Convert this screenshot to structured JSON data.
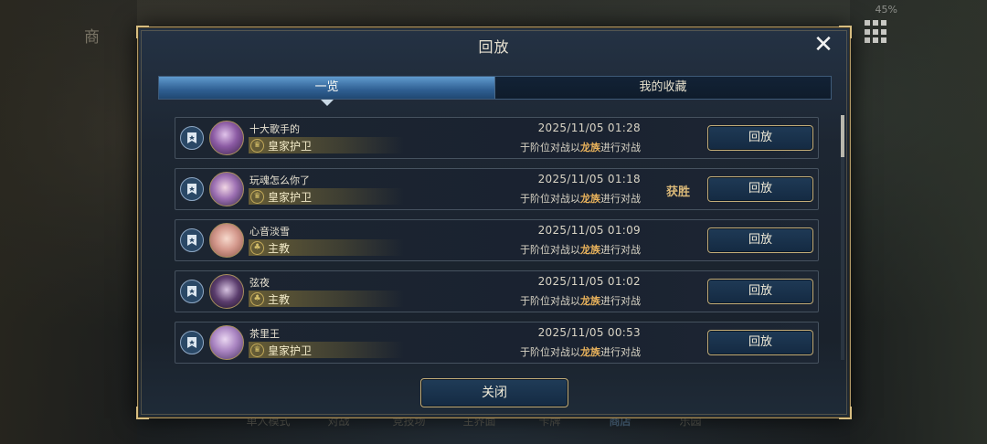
{
  "background": {
    "shop_label": "商",
    "status": {
      "battery": "45%"
    },
    "bottom_nav": [
      "单人模式",
      "对战",
      "竞技场",
      "主界面",
      "卡牌",
      "商店",
      "乐园"
    ]
  },
  "dialog": {
    "title": "回放",
    "close_icon": "close-x",
    "tabs": [
      {
        "label": "一览",
        "active": true
      },
      {
        "label": "我的收藏",
        "active": false
      }
    ],
    "rows": [
      {
        "name": "十大歌手的",
        "rank": "皇家护卫",
        "rank_icon": "crown",
        "datetime": "2025/11/05  01:28",
        "desc_prefix": "于阶位对战以",
        "desc_class": "龙族",
        "desc_suffix": "进行对战",
        "result": "",
        "button": "回放"
      },
      {
        "name": "玩魂怎么你了",
        "rank": "皇家护卫",
        "rank_icon": "crown",
        "datetime": "2025/11/05  01:18",
        "desc_prefix": "于阶位对战以",
        "desc_class": "龙族",
        "desc_suffix": "进行对战",
        "result": "获胜",
        "button": "回放"
      },
      {
        "name": "心音淡雪",
        "rank": "主教",
        "rank_icon": "leaf",
        "datetime": "2025/11/05  01:09",
        "desc_prefix": "于阶位对战以",
        "desc_class": "龙族",
        "desc_suffix": "进行对战",
        "result": "",
        "button": "回放"
      },
      {
        "name": "弦夜",
        "rank": "主教",
        "rank_icon": "leaf",
        "datetime": "2025/11/05  01:02",
        "desc_prefix": "于阶位对战以",
        "desc_class": "龙族",
        "desc_suffix": "进行对战",
        "result": "",
        "button": "回放"
      },
      {
        "name": "茶里王",
        "rank": "皇家护卫",
        "rank_icon": "crown",
        "datetime": "2025/11/05  00:53",
        "desc_prefix": "于阶位对战以",
        "desc_class": "龙族",
        "desc_suffix": "进行对战",
        "result": "",
        "button": "回放"
      }
    ],
    "close_button": "关闭"
  },
  "colors": {
    "accent_gold": "#c3ad78",
    "highlight_orange": "#e7b15b",
    "tab_active": "#2f5f92"
  }
}
